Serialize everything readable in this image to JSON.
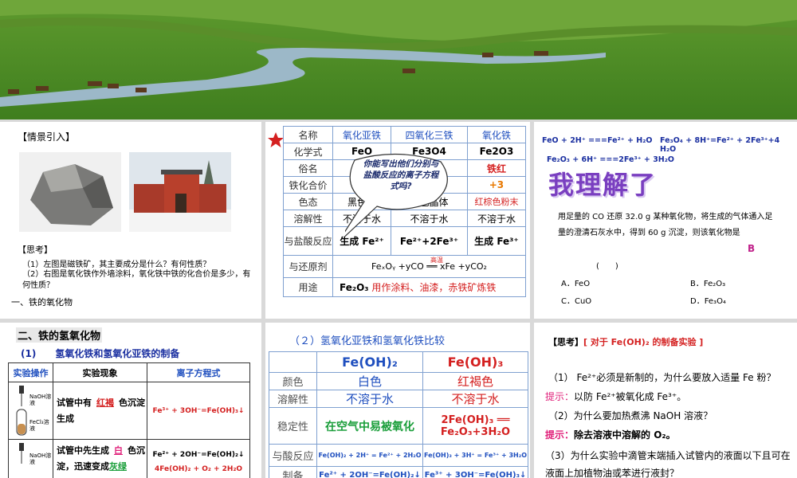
{
  "colors": {
    "accent_blue": "#1f4fbf",
    "accent_red": "#d42020",
    "accent_orange": "#e87800",
    "accent_pink": "#e0207a",
    "accent_green": "#1a9e3a",
    "accent_purple": "#7a3fc0"
  },
  "p1": {
    "heading": "【情景引入】",
    "think": "【思考】",
    "q1": "（1）左图是磁铁矿，其主要成分是什么？有何性质？",
    "q2": "（2）右图是氧化铁作外墙涂料，氧化铁中铁的化合价是多少，有何性质？",
    "section": "一、铁的氧化物"
  },
  "p2": {
    "headers": [
      "名称",
      "氧化亚铁",
      "四氧化三铁",
      "氧化铁"
    ],
    "rows": [
      {
        "label": "化学式",
        "c1": "FeO",
        "c2": "Fe3O4",
        "c3": "Fe2O3"
      },
      {
        "label": "俗名",
        "c1": "—",
        "c2": "",
        "c3": "铁红"
      },
      {
        "label": "铁化合价",
        "c1": "",
        "c2": "",
        "c3": "+3"
      },
      {
        "label": "色态",
        "c1": "黑色粉",
        "c2": "黑色晶体",
        "c3": "红棕色粉末"
      },
      {
        "label": "溶解性",
        "c1": "不溶于水",
        "c2": "不溶于水",
        "c3": "不溶于水"
      },
      {
        "label": "与盐酸反应",
        "c1": "生成 Fe²⁺",
        "c2": "Fe²⁺+2Fe³⁺",
        "c3": "生成 Fe³⁺"
      },
      {
        "label": "与还原剂",
        "eq": "FeₓOᵧ +yCO ══ xFe +yCO₂",
        "cond": "高温"
      },
      {
        "label": "用途",
        "u1": "Fe₂O₃",
        "u2": "用作涂料、油漆，赤铁矿炼铁"
      }
    ],
    "bubble": "你能写出他们分别与盐酸反应的离子方程式吗?"
  },
  "p3": {
    "eq1": "FeO + 2H⁺ ===Fe²⁺ + H₂O",
    "eq2": "Fe₃O₄ + 8H⁺=Fe²⁺ + 2Fe³⁺+4 H₂O",
    "eq3": "Fe₂O₃ + 6H⁺ ===2Fe³⁺ + 3H₂O",
    "understood": "我理解了",
    "problem": "用足量的 CO 还原 32.0 g 某种氧化物，将生成的气体通入足量的澄清石灰水中，得到 60 g 沉淀，则该氧化物是",
    "answer": "B",
    "paren": "(　　)",
    "opts": [
      "A．FeO",
      "B．Fe₂O₃",
      "C．CuO",
      "D．Fe₃O₄"
    ]
  },
  "p4": {
    "section": "二、铁的氢氧化物",
    "sub": "(1)　　氢氧化铁和氢氧化亚铁的制备",
    "headers": [
      "实验操作",
      "实验现象",
      "离子方程式"
    ],
    "r1": {
      "pre": "试管中有",
      "fill": "红褐",
      "post": "色沉淀生成",
      "eq": "Fe³⁺ + 3OH⁻=Fe(OH)₃↓",
      "tube_top": "NaOH溶液",
      "tube_bot": "FeCl₃溶液"
    },
    "r2": {
      "pre": "试管中先生成",
      "fill": "白",
      "post": "色沉淀，迅速变成",
      "fill2": "灰绿",
      "eq": "Fe²⁺ + 2OH⁻=Fe(OH)₂↓",
      "eq2": "4Fe(OH)₂ + O₂ + 2H₂O",
      "tube_top": "NaOH溶液"
    }
  },
  "p5": {
    "title": "（２）氢氧化亚铁和氢氧化铁比较",
    "h1": "Fe(OH)₂",
    "h2": "Fe(OH)₃",
    "rows": [
      {
        "label": "颜色",
        "a": "白色",
        "b": "红褐色"
      },
      {
        "label": "溶解性",
        "a": "不溶于水",
        "b": "不溶于水"
      },
      {
        "label": "稳定性",
        "a": "在空气中易被氧化",
        "b": "2Fe(OH)₃ ══ Fe₂O₃+3H₂O"
      },
      {
        "label": "与酸反应",
        "a": "Fe(OH)₂ + 2H⁺ = Fe²⁺ + 2H₂O",
        "b": "Fe(OH)₃ + 3H⁺ = Fe³⁺ + 3H₂O"
      },
      {
        "label": "制备",
        "a": "Fe²⁺ + 2OH⁻=Fe(OH)₂↓",
        "b": "Fe³⁺ + 3OH⁻=Fe(OH)₃↓"
      }
    ]
  },
  "p6": {
    "head": "【思考】",
    "head2": "[ 对于 Fe(OH)₂ 的制备实验 ]",
    "q1": "（1） Fe²⁺必须是新制的，为什么要放入适量 Fe 粉？",
    "hint": "提示：",
    "a1": "以防 Fe²⁺被氧化成 Fe³⁺。",
    "q2": "（2）为什么要加热煮沸 NaOH 溶液？",
    "a2": "除去溶液中溶解的 O₂。",
    "q3": "（3）为什么实验中滴管末端插入试管内的液面以下且可在液面上加植物油或苯进行液封？"
  }
}
